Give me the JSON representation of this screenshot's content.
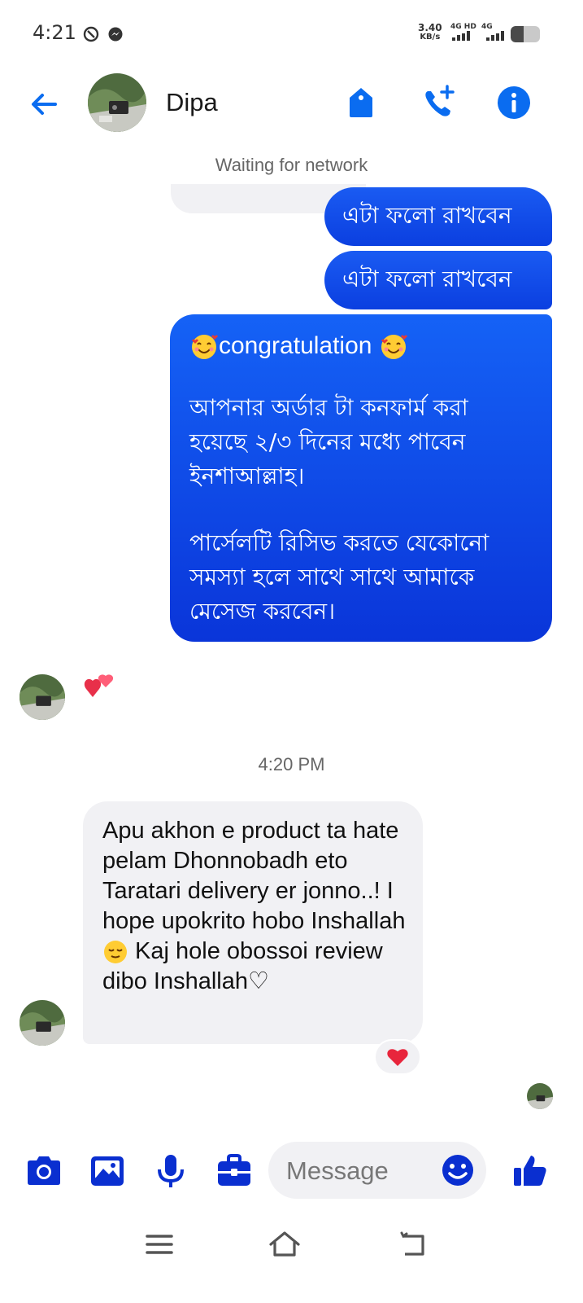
{
  "status_bar": {
    "time": "4:21",
    "speed_value": "3.40",
    "speed_unit": "KB/s",
    "net1": "4G HD",
    "net2": "4G",
    "battery_level": 0.45
  },
  "header": {
    "contact_name": "Dipa",
    "accent_color": "#0a6cf0"
  },
  "network_status": "Waiting for network",
  "messages": {
    "out1": "এটা ফলো রাখবেন",
    "out2": "এটা ফলো রাখবেন",
    "out3": {
      "congrats": "congratulation",
      "para1": "আপনার অর্ডার টা কনফার্ম করা হয়েছে  ২/৩  দিনের মধ্যে পাবেন ইনশাআল্লাহ।",
      "para2": "পার্সেলটি রিসিভ করতে যেকোনো সমস্যা হলে সাথে সাথে আমাকে মেসেজ করবেন।"
    },
    "timestamp": "4:20 PM",
    "in1": {
      "text": "Apu akhon e product ta hate pelam Dhonnobadh eto Taratari delivery er jonno..! I hope upokrito hobo Inshallah",
      "text_cont": " Kaj hole obossoi review dibo Inshallah♡",
      "reaction": "heart"
    }
  },
  "composer": {
    "placeholder": "Message"
  },
  "colors": {
    "outgoing_bubble": "#1a5bf2",
    "incoming_bubble": "#f1f1f4",
    "composer_icons": "#0a2fd0"
  }
}
